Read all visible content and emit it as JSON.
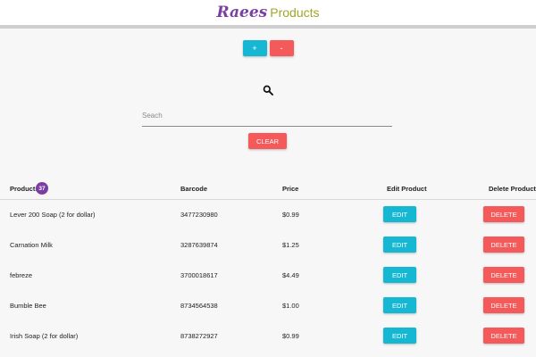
{
  "header": {
    "brand_script": "Raees",
    "brand_rest": "Products"
  },
  "controls": {
    "add_label": "+",
    "remove_label": "-"
  },
  "search": {
    "placeholder": "Seach",
    "value": "",
    "clear_label": "CLEAR"
  },
  "table": {
    "columns": {
      "products": "Products",
      "barcode": "Barcode",
      "price": "Price",
      "edit": "Edit Product",
      "delete": "Delete Product"
    },
    "product_count": "37",
    "edit_label": "EDIT",
    "delete_label": "DELETE",
    "rows": [
      {
        "name": "Lever 200 Soap (2 for dollar)",
        "barcode": "3477230980",
        "price": "$0.99"
      },
      {
        "name": "Carnation Milk",
        "barcode": "3287639874",
        "price": "$1.25"
      },
      {
        "name": "febreze",
        "barcode": "3700018617",
        "price": "$4.49"
      },
      {
        "name": "Bumble Bee",
        "barcode": "8734564538",
        "price": "$1.00"
      },
      {
        "name": "Irish Soap (2 for dollar)",
        "barcode": "8738272927",
        "price": "$0.99"
      }
    ]
  },
  "colors": {
    "brand_purple": "#7b3fa4",
    "brand_olive": "#a2a526",
    "accent_cyan": "#15b7d3",
    "accent_red": "#f45a5a"
  }
}
